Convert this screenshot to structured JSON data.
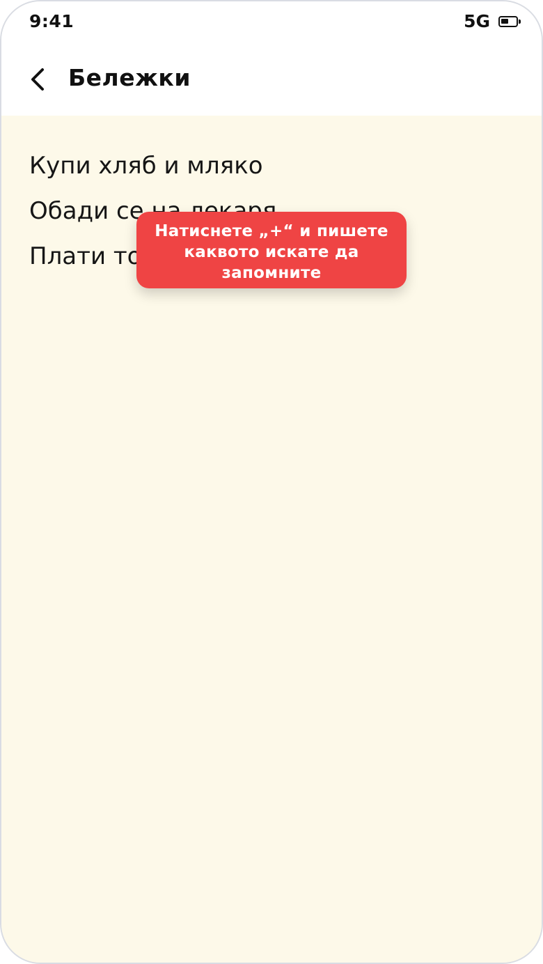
{
  "status_bar": {
    "time": "9:41",
    "network": "5G",
    "battery_level": 0.55
  },
  "header": {
    "back_icon": "chevron-left-icon",
    "title": "Бележки"
  },
  "notes": [
    "Купи хляб и мляко",
    "Обади се на лекаря",
    "Плати тока"
  ],
  "tooltip": {
    "text": "Натиснете „+“ и пишете каквото искате да запомните"
  },
  "colors": {
    "background": "#fdf9e9",
    "tooltip": "#ef4444",
    "text": "#161616"
  }
}
